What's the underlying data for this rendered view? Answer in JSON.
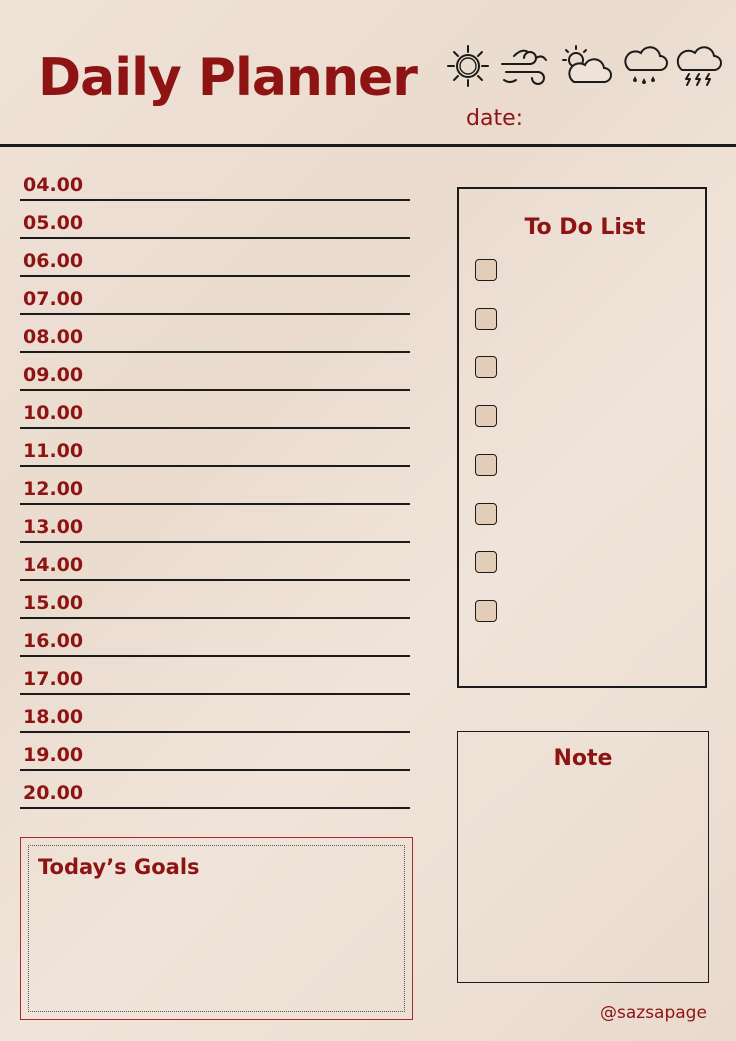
{
  "header": {
    "title": "Daily Planner",
    "date_label": "date:",
    "weather_icons": [
      "sun-icon",
      "windy-icon",
      "partly-cloudy-icon",
      "rain-cloud-icon",
      "storm-cloud-icon"
    ]
  },
  "schedule": {
    "hours": [
      "04.00",
      "05.00",
      "06.00",
      "07.00",
      "08.00",
      "09.00",
      "10.00",
      "11.00",
      "12.00",
      "13.00",
      "14.00",
      "15.00",
      "16.00",
      "17.00",
      "18.00",
      "19.00",
      "20.00"
    ]
  },
  "todo": {
    "title": "To Do List",
    "item_count": 8
  },
  "note": {
    "title": "Note"
  },
  "goals": {
    "title": "Today’s Goals"
  },
  "footer": {
    "handle": "@sazsapage"
  },
  "colors": {
    "accent": "#8e1414",
    "background": "#efe2d7",
    "line": "#1b1b1b",
    "checkbox_fill": "#e4cdb8"
  }
}
